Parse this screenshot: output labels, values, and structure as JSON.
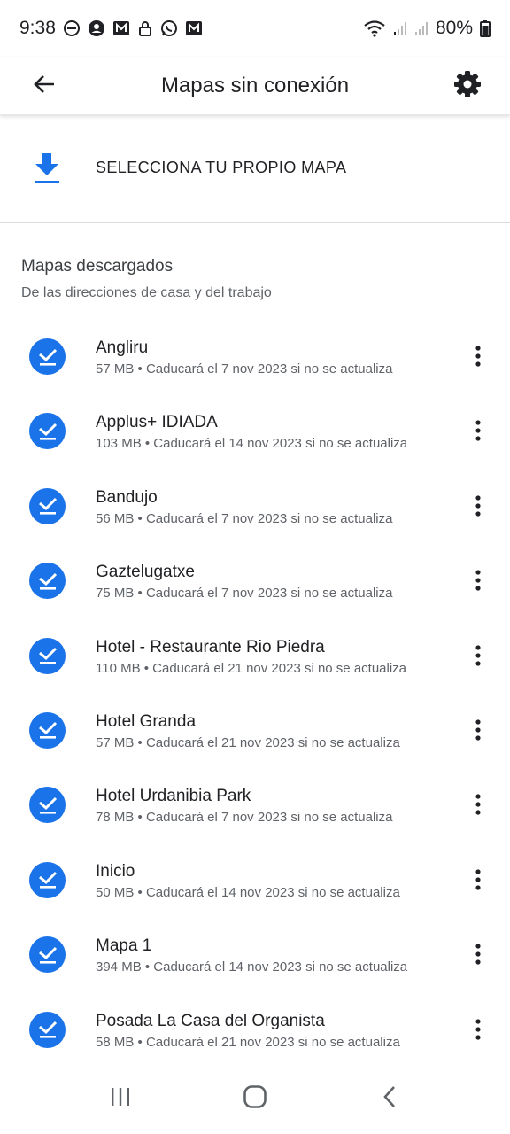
{
  "status_bar": {
    "time": "9:38",
    "battery": "80%",
    "notification_icons": [
      "do-not-disturb-icon",
      "account-circle-icon",
      "gmail-icon",
      "lock-icon",
      "whatsapp-icon",
      "gmail-icon"
    ],
    "right_icons": [
      "wifi-icon",
      "signal-icon",
      "signal-icon",
      "battery-icon"
    ]
  },
  "header": {
    "title": "Mapas sin conexión",
    "back_icon": "arrow-back-icon",
    "settings_icon": "gear-icon"
  },
  "select_map": {
    "label": "SELECCIONA TU PROPIO MAPA",
    "icon": "download-icon"
  },
  "downloaded": {
    "title": "Mapas descargados",
    "subtitle": "De las direcciones de casa y del trabajo"
  },
  "maps": [
    {
      "name": "Angliru",
      "detail": "57 MB • Caducará el 7 nov 2023 si no se actualiza"
    },
    {
      "name": "Applus+ IDIADA",
      "detail": "103 MB • Caducará el 14 nov 2023 si no se actualiza"
    },
    {
      "name": "Bandujo",
      "detail": "56 MB • Caducará el 7 nov 2023 si no se actualiza"
    },
    {
      "name": "Gaztelugatxe",
      "detail": "75 MB • Caducará el 7 nov 2023 si no se actualiza"
    },
    {
      "name": "Hotel - Restaurante Rio Piedra",
      "detail": "110 MB • Caducará el 21 nov 2023 si no se actualiza"
    },
    {
      "name": "Hotel Granda",
      "detail": "57 MB • Caducará el 21 nov 2023 si no se actualiza"
    },
    {
      "name": "Hotel Urdanibia Park",
      "detail": "78 MB • Caducará el 7 nov 2023 si no se actualiza"
    },
    {
      "name": "Inicio",
      "detail": "50 MB • Caducará el 14 nov 2023 si no se actualiza"
    },
    {
      "name": "Mapa 1",
      "detail": "394 MB • Caducará el 14 nov 2023 si no se actualiza"
    },
    {
      "name": "Posada La Casa del Organista",
      "detail": "58 MB • Caducará el 21 nov 2023 si no se actualiza"
    }
  ],
  "navbar": {
    "recents_icon": "recents-icon",
    "home_icon": "home-icon",
    "back_icon": "back-chevron-icon"
  },
  "colors": {
    "accent": "#1a73e8",
    "text_primary": "#202124",
    "text_secondary": "#5f6368",
    "divider": "#dadce0"
  }
}
